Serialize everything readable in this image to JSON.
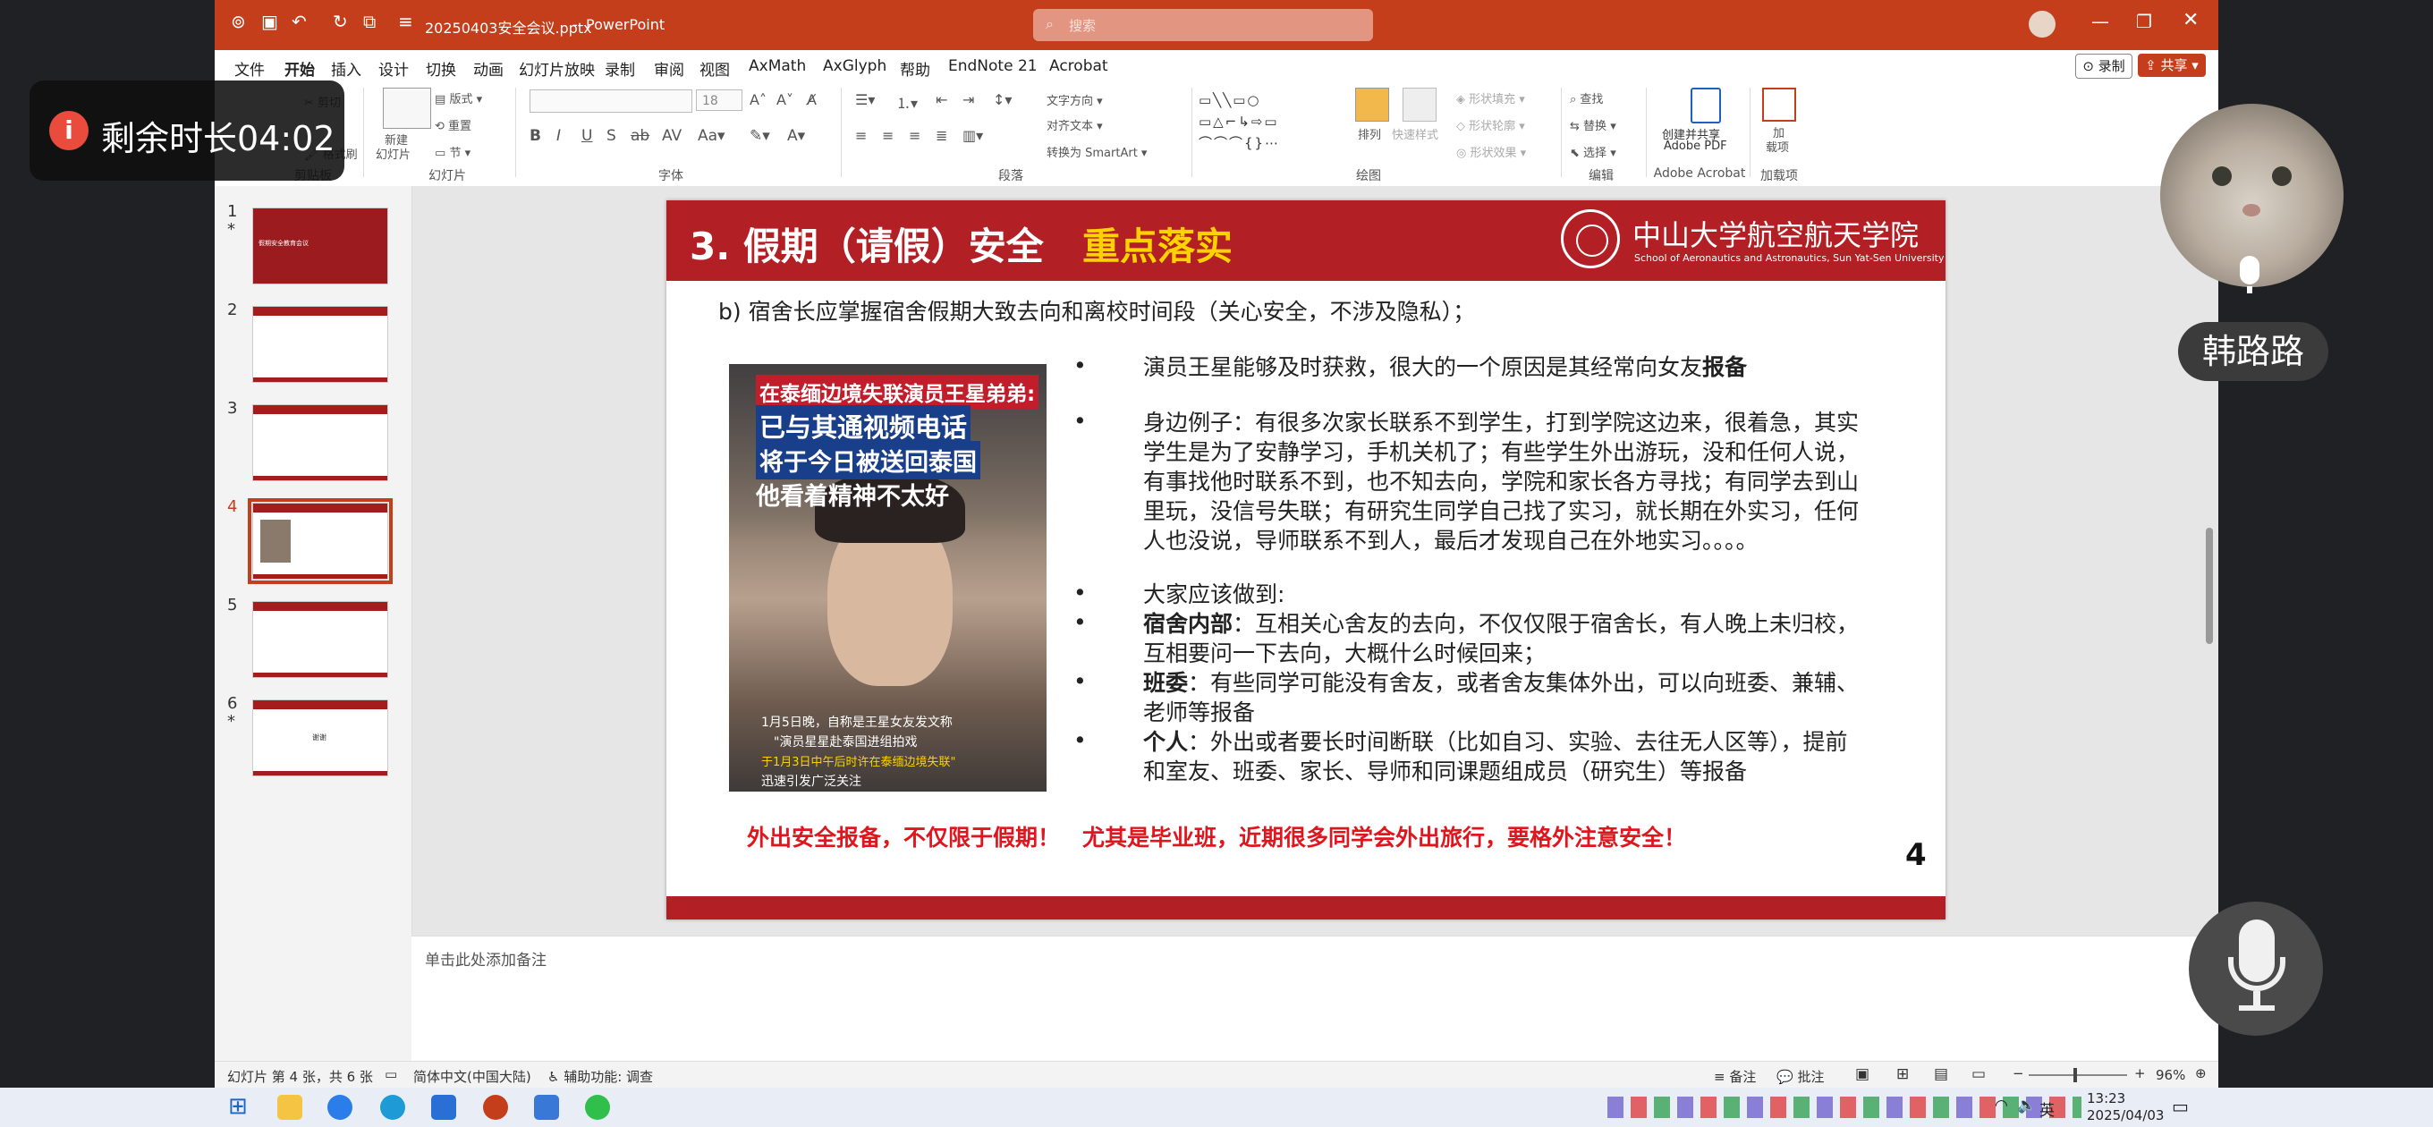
{
  "app": {
    "filename": "20250403安全会议.pptx",
    "separator": "-",
    "app_name": "PowerPoint",
    "search_placeholder": "搜索",
    "record_label": "录制",
    "share_label": "共享"
  },
  "menu": [
    "文件",
    "开始",
    "插入",
    "设计",
    "切换",
    "动画",
    "幻灯片放映",
    "录制",
    "审阅",
    "视图",
    "AxMath",
    "AxGlyph",
    "帮助",
    "EndNote 21",
    "Acrobat"
  ],
  "ribbon": {
    "groups": {
      "clipboard": "剪贴板",
      "slides": "幻灯片",
      "font": "字体",
      "paragraph": "段落",
      "drawing": "绘图",
      "editing": "编辑",
      "acrobat": "Adobe Acrobat",
      "addins": "加载项"
    },
    "clipboard_cut": "剪切",
    "clipboard_format": "格式刷",
    "new_slide": "新建",
    "new_slide_2": "幻灯片",
    "layout": "版式",
    "reset": "重置",
    "section": "节",
    "font_size": "18",
    "text_direction": "文字方向",
    "align_text": "对齐文本",
    "smartart": "转换为 SmartArt",
    "arrange": "排列",
    "quick_styles": "快速样式",
    "shape_fill": "形状填充",
    "shape_outline": "形状轮廓",
    "shape_effects": "形状效果",
    "find": "查找",
    "replace": "替换",
    "select": "选择",
    "create_pdf": "创建并共享",
    "create_pdf_2": "Adobe PDF",
    "addins_btn": "加",
    "addins_btn_2": "载项"
  },
  "thumbnails": [
    {
      "num": "1",
      "star": "*",
      "text": "假期安全教育会议"
    },
    {
      "num": "2",
      "star": "",
      "text": ""
    },
    {
      "num": "3",
      "star": "",
      "text": ""
    },
    {
      "num": "4",
      "star": "",
      "text": ""
    },
    {
      "num": "5",
      "star": "",
      "text": ""
    },
    {
      "num": "6",
      "star": "*",
      "text": "谢谢"
    }
  ],
  "slide": {
    "title_main": "3. 假期（请假）安全",
    "title_highlight": "重点落实",
    "university": "中山大学航空航天学院",
    "university_en": "School of Aeronautics and Astronautics, Sun Yat-Sen University",
    "subtitle": "b) 宿舍长应掌握宿舍假期大致去向和离校时间段（关心安全，不涉及隐私）；",
    "photo": {
      "headline1": "在泰缅边境失联演员王星弟弟:",
      "headline2": "已与其通视频电话",
      "headline3": "将于今日被送回泰国",
      "headline4": "他看着精神不太好",
      "caption1": "1月5日晚，自称是王星女友发文称",
      "caption2": "\"演员星星赴泰国进组拍戏",
      "caption3": "于1月3日中午后时许在泰缅边境失联\"",
      "caption4": "迅速引发广泛关注"
    },
    "bullet1_pre": "演员王星能够及时获救，很大的一个原因是其经常向女友",
    "bullet1_bold": "报备",
    "bullet2_lines": [
      "身边例子：有很多次家长联系不到学生，打到学院这边来，很着急，其实",
      "学生是为了安静学习，手机关机了；有些学生外出游玩，没和任何人说，",
      "有事找他时联系不到，也不知去向，学院和家长各方寻找；有同学去到山",
      "里玩，没信号失联；有研究生同学自己找了实习，就长期在外实习，任何",
      "人也没说，导师联系不到人，最后才发现自己在外地实习。。。。"
    ],
    "bullet3": "大家应该做到:",
    "bullet4_bold": "宿舍内部",
    "bullet4_line1": "：互相关心舍友的去向，不仅仅限于宿舍长，有人晚上未归校，",
    "bullet4_line2": "互相要问一下去向，大概什么时候回来；",
    "bullet5_bold": "班委",
    "bullet5_line1": "：有些同学可能没有舍友，或者舍友集体外出，可以向班委、兼辅、",
    "bullet5_line2": "老师等报备",
    "bullet6_bold": "个人",
    "bullet6_line1": "：外出或者要长时间断联（比如自习、实验、去往无人区等），提前",
    "bullet6_line2": "和室友、班委、家长、导师和同课题组成员（研究生）等报备",
    "warning": "外出安全报备，不仅限于假期！　尤其是毕业班，近期很多同学会外出旅行，要格外注意安全！",
    "page_number": "4"
  },
  "notes_placeholder": "单击此处添加备注",
  "status": {
    "slide_info": "幻灯片 第 4 张，共 6 张",
    "language": "简体中文(中国大陆)",
    "accessibility": "辅助功能: 调查",
    "notes_btn": "备注",
    "comments_btn": "批注",
    "zoom": "96%"
  },
  "overlay": {
    "timer_label": "剩余时长04:02",
    "participant_name": "韩路路"
  },
  "taskbar": {
    "ime": "英",
    "time": "13:23",
    "date": "2025/04/03"
  },
  "colors": {
    "ppt_accent": "#c43e1c",
    "slide_red": "#b21f24",
    "highlight_yellow": "#ffd200",
    "warning_red": "#e0161e"
  }
}
